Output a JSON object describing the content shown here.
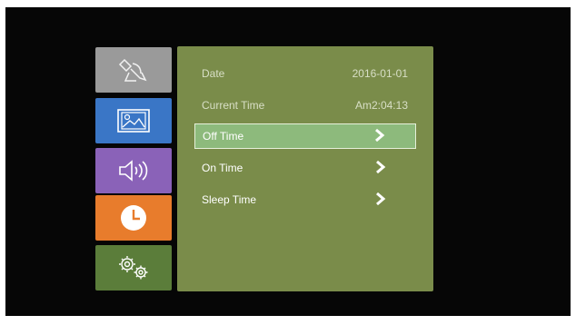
{
  "menu": {
    "tiles": [
      {
        "icon": "satellite-dish-icon",
        "color": "#9a9a9a"
      },
      {
        "icon": "picture-icon",
        "color": "#3a76c6"
      },
      {
        "icon": "speaker-icon",
        "color": "#8a62b8"
      },
      {
        "icon": "clock-icon",
        "color": "#e87c2c"
      },
      {
        "icon": "gears-icon",
        "color": "#5b7d3a"
      }
    ],
    "selected_tile": "clock-icon"
  },
  "time_settings": {
    "date_label": "Date",
    "date_value": "2016-01-01",
    "current_time_label": "Current Time",
    "current_time_value": "Am2:04:13",
    "off_time_label": "Off Time",
    "on_time_label": "On Time",
    "sleep_time_label": "Sleep Time",
    "selected_row": "Off Time"
  },
  "colors": {
    "panel": "#7a8c4a",
    "highlight": "#8dba7c",
    "background": "#060606"
  }
}
